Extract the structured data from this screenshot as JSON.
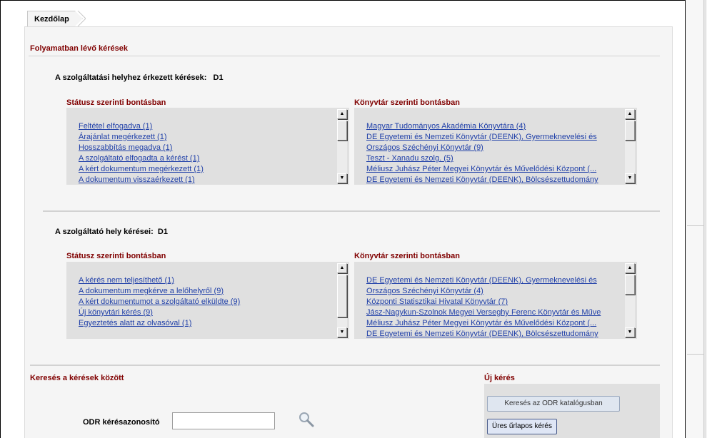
{
  "breadcrumb": {
    "home": "Kezdőlap"
  },
  "in_progress": {
    "title": "Folyamatban lévő kérések",
    "received": {
      "label": "A szolgáltatási helyhez érkezett kérések:",
      "location": "D1",
      "status_title": "Státusz szerinti bontásban",
      "library_title": "Könyvtár szerinti bontásban",
      "status_items": [
        "Feltétel elfogadva (1)",
        "Árajánlat megérkezett (1)",
        "Hosszabbítás megadva (1)",
        "A szolgáltató elfogadta a kérést (1)",
        "A kért dokumentum megérkezett (1)",
        "A dokumentum visszaérkezett (1)"
      ],
      "library_items": [
        "Magyar Tudományos Akadémia Könyvtára (4)",
        "DE Egyetemi és Nemzeti Könyvtár (DEENK), Gyermeknevelési és",
        "Országos Széchényi Könyvtár (9)",
        "Teszt - Xanadu szolg. (5)",
        "Méliusz Juhász Péter Megyei Könyvtár és Művelődési Központ (...",
        "DE Egyetemi és Nemzeti Könyvtár (DEENK), Bölcsészettudomány"
      ]
    },
    "own": {
      "label": "A szolgáltató hely kérései:",
      "location": "D1",
      "status_title": "Státusz szerinti bontásban",
      "library_title": "Könyvtár szerinti bontásban",
      "status_items": [
        "A kérés nem teljesíthető (1)",
        "A dokumentum megkérve a lelőhelyről (9)",
        "A kért dokumentumot a szolgáltató elküldte (9)",
        "Új könyvtári kérés (9)",
        "Egyeztetés alatt az olvasóval (1)"
      ],
      "library_items": [
        "DE Egyetemi és Nemzeti Könyvtár (DEENK), Gyermeknevelési és",
        "Országos Széchényi Könyvtár (4)",
        "Központi Statisztikai Hivatal Könyvtár (7)",
        "Jász-Nagykun-Szolnok Megyei Verseghy Ferenc Könyvtár és Műve",
        "Méliusz Juhász Péter Megyei Könyvtár és Művelődési Központ (...",
        "DE Egyetemi és Nemzeti Könyvtár (DEENK), Bölcsészettudomány"
      ]
    }
  },
  "search": {
    "title": "Keresés a kérések között",
    "odr_label": "ODR kérésazonosító",
    "odr_value": ""
  },
  "new_request": {
    "title": "Új kérés",
    "catalog_button": "Keresés az ODR katalógusban",
    "blank_form_button": "Üres űrlapos kérés"
  },
  "icons": {
    "search": "magnifier-icon",
    "scroll_up": "arrow-up-icon",
    "scroll_down": "arrow-down-icon"
  },
  "colors": {
    "section_title": "#800000",
    "link": "#1f3fa8",
    "panel_bg": "#f5f5f5",
    "listbox_bg": "#e0e0e0"
  }
}
